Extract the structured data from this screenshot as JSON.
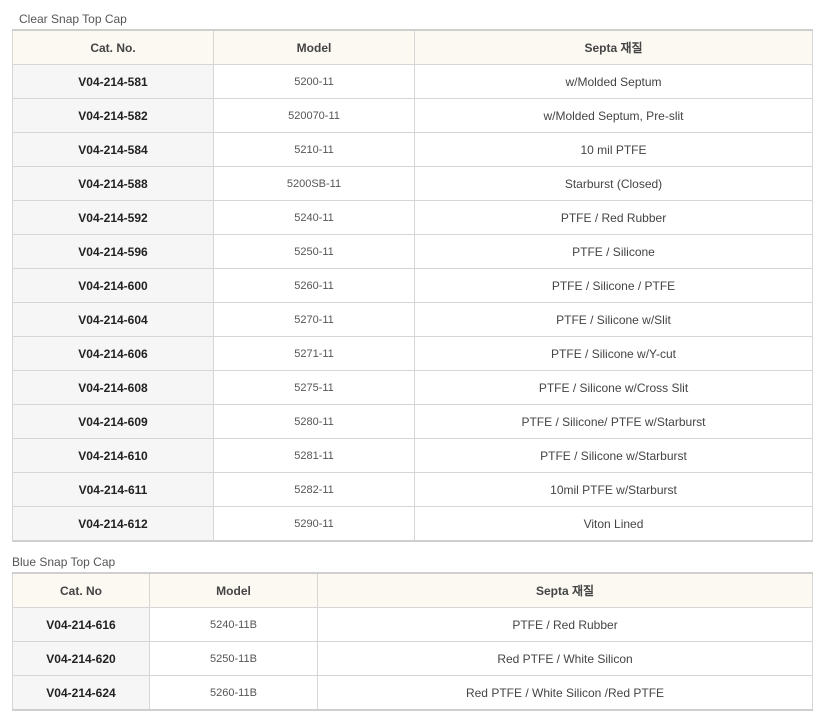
{
  "clear_section": {
    "title": "Clear Snap Top Cap",
    "headers": [
      "Cat. No.",
      "Model",
      "Septa 재질"
    ],
    "rows": [
      {
        "cat": "V04-214-581",
        "model": "5200-11",
        "septa": "w/Molded Septum"
      },
      {
        "cat": "V04-214-582",
        "model": "520070-11",
        "septa": "w/Molded Septum, Pre-slit"
      },
      {
        "cat": "V04-214-584",
        "model": "5210-11",
        "septa": "10 mil PTFE"
      },
      {
        "cat": "V04-214-588",
        "model": "5200SB-11",
        "septa": "Starburst (Closed)"
      },
      {
        "cat": "V04-214-592",
        "model": "5240-11",
        "septa": "PTFE / Red Rubber"
      },
      {
        "cat": "V04-214-596",
        "model": "5250-11",
        "septa": "PTFE / Silicone"
      },
      {
        "cat": "V04-214-600",
        "model": "5260-11",
        "septa": "PTFE / Silicone / PTFE"
      },
      {
        "cat": "V04-214-604",
        "model": "5270-11",
        "septa": "PTFE / Silicone w/Slit"
      },
      {
        "cat": "V04-214-606",
        "model": "5271-11",
        "septa": "PTFE / Silicone w/Y-cut"
      },
      {
        "cat": "V04-214-608",
        "model": "5275-11",
        "septa": "PTFE / Silicone w/Cross Slit"
      },
      {
        "cat": "V04-214-609",
        "model": "5280-11",
        "septa": "PTFE / Silicone/ PTFE w/Starburst"
      },
      {
        "cat": "V04-214-610",
        "model": "5281-11",
        "septa": "PTFE / Silicone w/Starburst"
      },
      {
        "cat": "V04-214-611",
        "model": "5282-11",
        "septa": "10mil PTFE w/Starburst"
      },
      {
        "cat": "V04-214-612",
        "model": "5290-11",
        "septa": "Viton Lined"
      }
    ]
  },
  "blue_section": {
    "title": "Blue Snap Top Cap",
    "headers": [
      "Cat. No",
      "Model",
      "Septa 재질"
    ],
    "rows": [
      {
        "cat": "V04-214-616",
        "model": "5240-11B",
        "septa": "PTFE / Red Rubber"
      },
      {
        "cat": "V04-214-620",
        "model": "5250-11B",
        "septa": "Red PTFE / White Silicon"
      },
      {
        "cat": "V04-214-624",
        "model": "5260-11B",
        "septa": "Red PTFE / White Silicon /Red PTFE"
      }
    ]
  }
}
